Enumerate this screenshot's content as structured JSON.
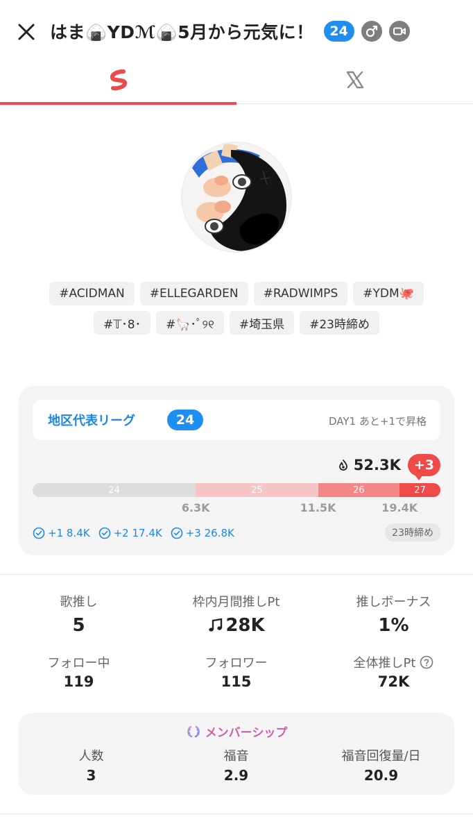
{
  "header": {
    "close_icon": "close-icon",
    "title": "はま🍙YDℳ🍙5月から元気に！",
    "league_badge": "24",
    "gender_icon": "male-icon",
    "video_icon": "video-camera-icon"
  },
  "tabs": [
    {
      "icon": "stand-fm-logo-icon",
      "active": true
    },
    {
      "icon": "x-logo-icon",
      "active": false
    }
  ],
  "tags": {
    "row1": [
      "#ACIDMAN",
      "#ELLEGARDEN",
      "#RADWIMPS",
      "#YDM🐙"
    ],
    "row2": [
      "#𝕋･8･",
      "#🦙･ﾟ୨୧",
      "#埼玉県",
      "#23時締め"
    ]
  },
  "league": {
    "name": "地区代表リーグ",
    "badge": "24",
    "status": "DAY1 あと+1で昇格",
    "points": "52.3K",
    "delta": "+3",
    "segments": [
      {
        "label": "24",
        "share": 0.4,
        "color": "#dddddd"
      },
      {
        "label": "25",
        "share": 0.3,
        "color": "#f7c5c5"
      },
      {
        "label": "26",
        "share": 0.2,
        "color": "#f38787"
      },
      {
        "label": "27",
        "share": 0.1,
        "color": "#ee4a4a"
      }
    ],
    "thresholds": [
      {
        "label": "6.3K",
        "at": 0.4
      },
      {
        "label": "11.5K",
        "at": 0.7
      },
      {
        "label": "19.4K",
        "at": 0.9
      }
    ],
    "bonuses": [
      "+1 8.4K",
      "+2 17.4K",
      "+3 26.8K"
    ],
    "deadline": "23時締め",
    "accent": "#1a87e0"
  },
  "stats": {
    "song_push_label": "歌推し",
    "song_push_value": "5",
    "monthly_pt_label": "枠内月間推しPt",
    "monthly_pt_value": "28K",
    "bonus_label": "推しボーナス",
    "bonus_value": "1%",
    "following_label": "フォロー中",
    "following_value": "119",
    "followers_label": "フォロワー",
    "followers_value": "115",
    "total_pt_label": "全体推しPt",
    "total_pt_value": "72K"
  },
  "membership": {
    "title": "メンバーシップ",
    "members_label": "人数",
    "members_value": "3",
    "fukuon_label": "福音",
    "fukuon_value": "2.9",
    "recovery_label": "福音回復量/日",
    "recovery_value": "20.9"
  }
}
